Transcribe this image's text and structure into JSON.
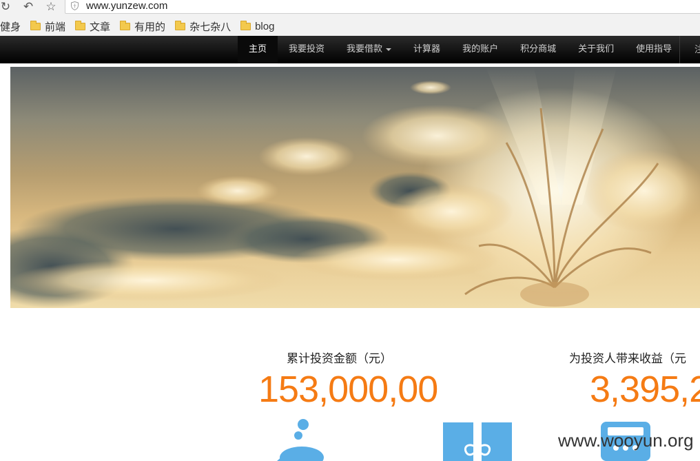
{
  "browser": {
    "url": "www.yunzew.com",
    "bookmarks": [
      {
        "label": "健身",
        "icon": "none"
      },
      {
        "label": "前端",
        "icon": "folder-icon"
      },
      {
        "label": "文章",
        "icon": "folder-icon"
      },
      {
        "label": "有用的",
        "icon": "folder-icon"
      },
      {
        "label": "杂七杂八",
        "icon": "folder-icon"
      },
      {
        "label": "blog",
        "icon": "folder-icon"
      }
    ]
  },
  "site_nav": {
    "items": [
      {
        "label": "主页",
        "active": true
      },
      {
        "label": "我要投资"
      },
      {
        "label": "我要借款",
        "has_dropdown": true
      },
      {
        "label": "计算器"
      },
      {
        "label": "我的账户"
      },
      {
        "label": "积分商城"
      },
      {
        "label": "关于我们"
      },
      {
        "label": "使用指导"
      }
    ],
    "cut_item": "注"
  },
  "stats": {
    "total_investment_label": "累计投资金额（元）",
    "total_investment_value": "153,000,00",
    "investor_earnings_label": "为投资人带来收益（元",
    "investor_earnings_value": "3,395,2"
  },
  "watermark": "www.wooyun.org",
  "colors": {
    "accent_orange": "#f57b14",
    "icon_blue": "#5aaee6",
    "nav_bg": "#111111"
  }
}
